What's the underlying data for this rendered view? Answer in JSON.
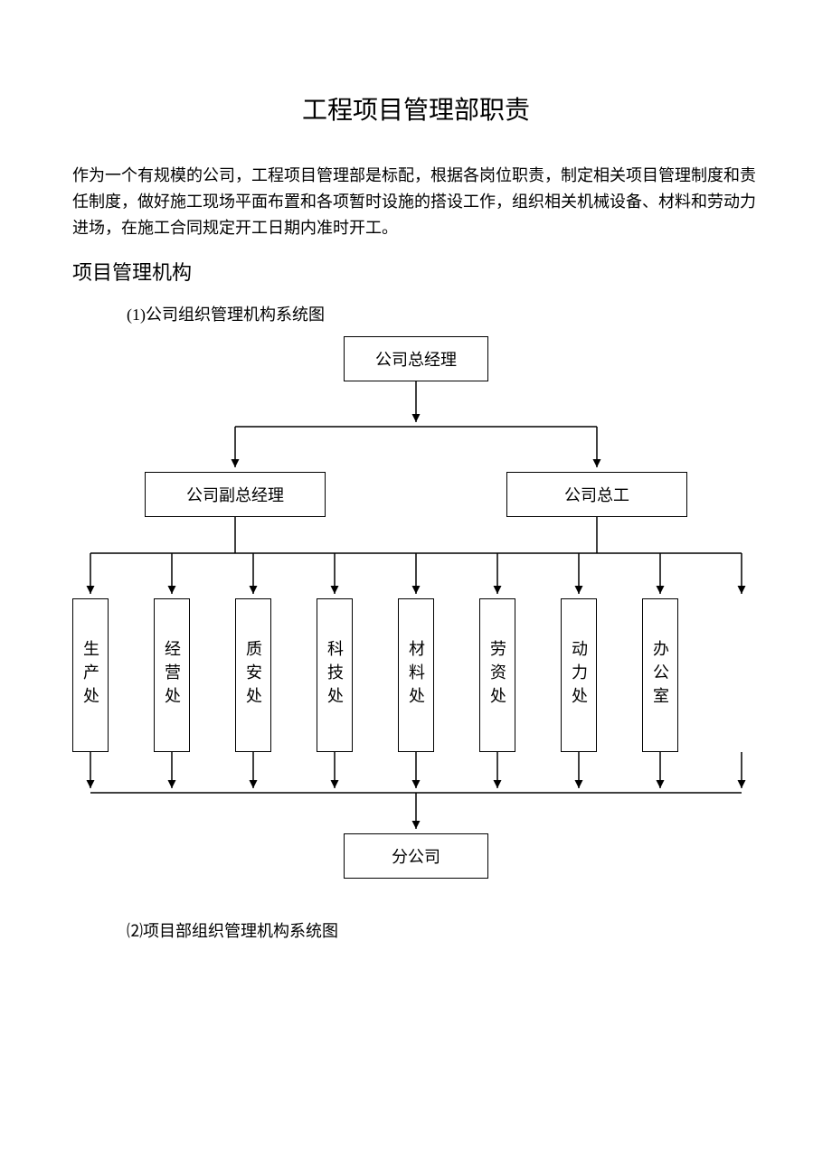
{
  "title": "工程项目管理部职责",
  "intro": "作为一个有规模的公司，工程项目管理部是标配，根据各岗位职责，制定相关项目管理制度和责任制度，做好施工现场平面布置和各项暂时设施的搭设工作，组织相关机械设备、材料和劳动力进场，在施工合同规定开工日期内准时开工。",
  "section_heading": "项目管理机构",
  "sub1": "(1)公司组织管理机构系统图",
  "sub2": "⑵项目部组织管理机构系统图",
  "chart_data": {
    "type": "diagram",
    "title": "公司组织管理机构系统图",
    "nodes": {
      "top": "公司总经理",
      "mid_left": "公司副总经理",
      "mid_right": "公司总工",
      "departments": [
        "生产处",
        "经营处",
        "质安处",
        "科技处",
        "材料处",
        "劳资处",
        "动力处",
        "办公室"
      ],
      "bottom": "分公司"
    },
    "edges_desc": "top → mid_left, top → mid_right; mid_left → 生产处/经营处/质安处/科技处/材料处; mid_right → 材料处/劳资处/动力处/办公室; 所有 departments → 分公司"
  }
}
